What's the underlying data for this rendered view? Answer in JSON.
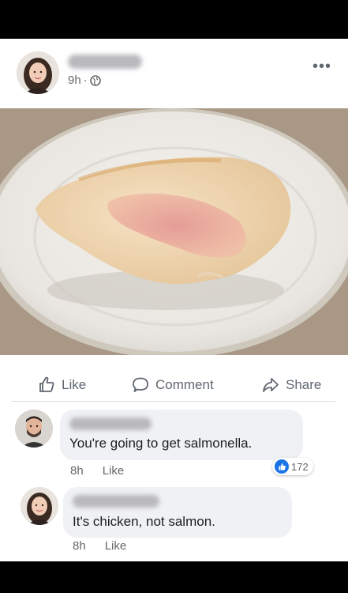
{
  "post": {
    "time": "9h",
    "separator": "·",
    "privacy_icon": "globe-icon",
    "more_icon": "more-dots-icon",
    "more_label": "•••",
    "photo_alt": "chicken-breast-plate-photo"
  },
  "actions": {
    "like_label": "Like",
    "comment_label": "Comment",
    "share_label": "Share"
  },
  "comments": [
    {
      "text": "You're going to get salmonella.",
      "time": "8h",
      "like_label": "Like",
      "reaction_count": "172",
      "reaction_icon": "thumbs-up-icon"
    },
    {
      "text": "It's chicken, not salmon.",
      "time": "8h",
      "like_label": "Like"
    }
  ],
  "colors": {
    "like_blue": "#1b74e4",
    "muted_text": "#65676b",
    "bubble_bg": "#eff1f4",
    "frame_bg": "#000000"
  }
}
